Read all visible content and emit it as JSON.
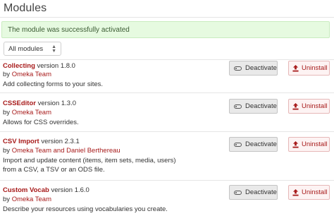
{
  "page": {
    "title": "Modules"
  },
  "flash": {
    "message": "The module was successfully activated"
  },
  "filter": {
    "selected": "All modules"
  },
  "actions": {
    "deactivate_label": "Deactivate",
    "uninstall_label": "Uninstall"
  },
  "modules": [
    {
      "name": "Collecting",
      "version": " version 1.8.0",
      "by": "by ",
      "author": "Omeka Team",
      "description": [
        "Add collecting forms to your sites."
      ]
    },
    {
      "name": "CSSEditor",
      "version": " version 1.3.0",
      "by": "by ",
      "author": "Omeka Team",
      "description": [
        "Allows for CSS overrides."
      ]
    },
    {
      "name": "CSV Import",
      "version": " version 2.3.1",
      "by": "by ",
      "author": "Omeka Team and Daniel Berthereau",
      "description": [
        "Import and update content (items, item sets, media, users)",
        "from a CSV, a TSV or an ODS file."
      ]
    },
    {
      "name": "Custom Vocab",
      "version": " version 1.6.0",
      "by": "by ",
      "author": "Omeka Team",
      "description": [
        "Describe your resources using vocabularies you create."
      ]
    }
  ]
}
